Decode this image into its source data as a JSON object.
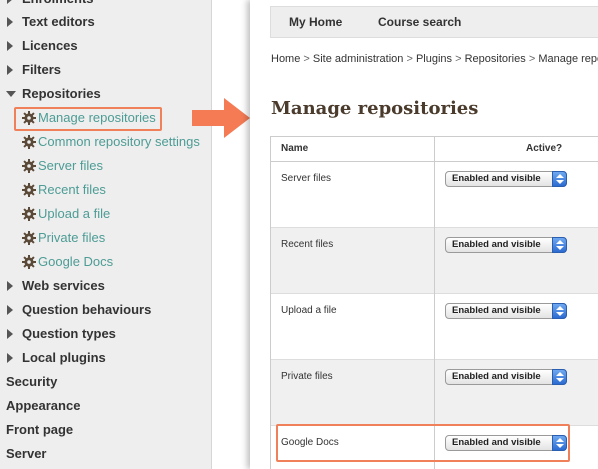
{
  "sidebar": {
    "items_above": [
      {
        "label": "Enrolments",
        "expander": "right"
      },
      {
        "label": "Text editors",
        "expander": "right"
      },
      {
        "label": "Licences",
        "expander": "right"
      },
      {
        "label": "Filters",
        "expander": "right"
      },
      {
        "label": "Repositories",
        "expander": "down"
      }
    ],
    "repositories_children": [
      {
        "label": "Manage repositories",
        "icon": "gear-icon"
      },
      {
        "label": "Common repository settings",
        "icon": "gear-icon"
      },
      {
        "label": "Server files",
        "icon": "gear-icon"
      },
      {
        "label": "Recent files",
        "icon": "gear-icon"
      },
      {
        "label": "Upload a file",
        "icon": "gear-icon"
      },
      {
        "label": "Private files",
        "icon": "gear-icon"
      },
      {
        "label": "Google Docs",
        "icon": "gear-icon"
      }
    ],
    "items_below": [
      {
        "label": "Web services",
        "expander": "right"
      },
      {
        "label": "Question behaviours",
        "expander": "right"
      },
      {
        "label": "Question types",
        "expander": "right"
      },
      {
        "label": "Local plugins",
        "expander": "right"
      }
    ],
    "top_level": [
      {
        "label": "Security"
      },
      {
        "label": "Appearance"
      },
      {
        "label": "Front page"
      },
      {
        "label": "Server"
      }
    ]
  },
  "topbar": {
    "tabs": [
      "My Home",
      "Course search"
    ]
  },
  "breadcrumb": [
    "Home",
    "Site administration",
    "Plugins",
    "Repositories",
    "Manage repo"
  ],
  "breadcrumb_sep": ">",
  "page_title": "Manage repositories",
  "table": {
    "headers": {
      "name": "Name",
      "active": "Active?"
    },
    "rows": [
      {
        "name": "Server files",
        "active": "Enabled and visible"
      },
      {
        "name": "Recent files",
        "active": "Enabled and visible"
      },
      {
        "name": "Upload a file",
        "active": "Enabled and visible"
      },
      {
        "name": "Private files",
        "active": "Enabled and visible"
      },
      {
        "name": "Google Docs",
        "active": "Enabled and visible"
      }
    ]
  },
  "colors": {
    "link": "#4d9c95",
    "highlight": "#f0805a",
    "select_stepper": "#2c6bd1",
    "title": "#4a3b2c"
  }
}
